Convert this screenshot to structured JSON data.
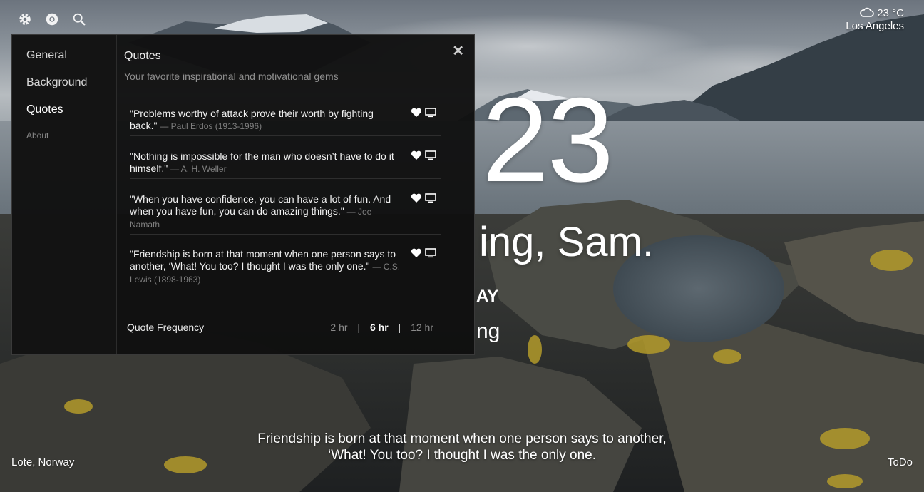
{
  "weather": {
    "temperature": "23 °C",
    "location": "Los Angeles"
  },
  "clock": {
    "time": "23"
  },
  "greeting": {
    "text": "ing, Sam."
  },
  "focus": {
    "partial_heading": "AY",
    "partial_text": "ng"
  },
  "bottom_quote": {
    "line1": "Friendship is born at that moment when one person says to another,",
    "line2": "‘What! You too? I thought I was the only one."
  },
  "footer": {
    "photo_location": "Lote, Norway",
    "todo_label": "ToDo"
  },
  "settings": {
    "nav": [
      {
        "label": "General"
      },
      {
        "label": "Background"
      },
      {
        "label": "Quotes"
      },
      {
        "label": "About"
      }
    ],
    "close_symbol": "✕",
    "title": "Quotes",
    "subtitle": "Your favorite inspirational and motivational gems",
    "quotes": [
      {
        "text": "\"Problems worthy of attack prove their worth by fighting back.\"",
        "author": "— Paul Erdos (1913-1996)"
      },
      {
        "text": "\"Nothing is impossible for the man who doesn’t have to do it himself.\"",
        "author": "— A. H. Weller"
      },
      {
        "text": "\"When you have confidence, you can have a lot of fun. And when you have fun, you can do amazing things.\"",
        "author": "— Joe Namath"
      },
      {
        "text": "\"Friendship is born at that moment when one person says to another, ‘What! You too? I thought I was the only one.\"",
        "author": "— C.S. Lewis (1898-1963)"
      }
    ],
    "frequency": {
      "label": "Quote Frequency",
      "options": [
        "2 hr",
        "6 hr",
        "12 hr"
      ],
      "selected": "6 hr",
      "separator": "|"
    }
  }
}
